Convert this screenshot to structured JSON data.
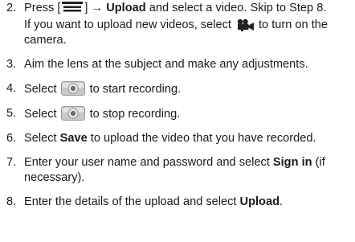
{
  "steps": [
    {
      "num": "2.",
      "parts": {
        "a": "Press [",
        "b": "] → ",
        "c": "Upload",
        "d": " and select a video. Skip to Step 8."
      },
      "sub": {
        "a": "If you want to upload new videos, select",
        "b": "to turn on the camera."
      },
      "icons": [
        "menu-key-icon",
        "video-camera-icon"
      ]
    },
    {
      "num": "3.",
      "text": "Aim the lens at the subject and make any adjustments."
    },
    {
      "num": "4.",
      "a": "Select",
      "b": "to start recording.",
      "icon": "record-button-icon"
    },
    {
      "num": "5.",
      "a": "Select",
      "b": "to stop recording.",
      "icon": "record-button-icon"
    },
    {
      "num": "6.",
      "a": "Select ",
      "bold": "Save",
      "b": " to upload the video that you have recorded."
    },
    {
      "num": "7.",
      "a": "Enter your user name and password and select ",
      "bold": "Sign in",
      "b": " (if necessary)."
    },
    {
      "num": "8.",
      "a": "Enter the details of the upload and select ",
      "bold": "Upload",
      "b": "."
    }
  ],
  "colors": {
    "text": "#1a1a1a",
    "icon_dark": "#222222",
    "button_fill": "#c8c8c8",
    "button_center": "#6d6d6d"
  }
}
